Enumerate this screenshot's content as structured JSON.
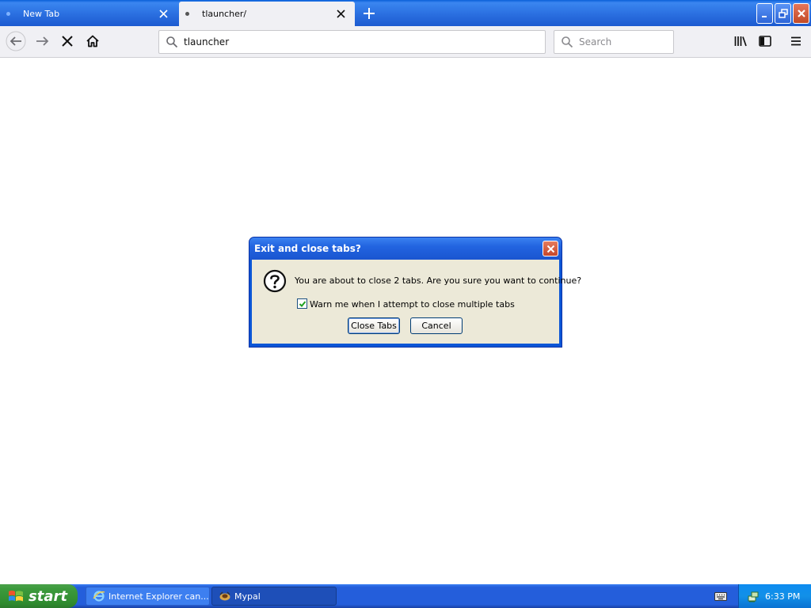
{
  "browser": {
    "tabs": [
      {
        "title": "New Tab",
        "active": false
      },
      {
        "title": "tlauncher/",
        "active": true
      }
    ],
    "url": "tlauncher",
    "search_placeholder": "Search"
  },
  "dialog": {
    "title": "Exit and close tabs?",
    "message": "You are about to close 2 tabs. Are you sure you want to continue?",
    "checkbox_label": "Warn me when I attempt to close multiple tabs",
    "checkbox_checked": true,
    "primary_button": "Close Tabs",
    "secondary_button": "Cancel"
  },
  "taskbar": {
    "start_label": "start",
    "items": [
      {
        "label": "Internet Explorer can...",
        "icon": "internet-explorer-icon"
      },
      {
        "label": "Mypal",
        "icon": "mypal-icon"
      }
    ],
    "clock": "6:33 PM"
  },
  "colors": {
    "titlebar": "#2a6fe0",
    "toolbar": "#f0f0f4",
    "dialog_body": "#ece9d8",
    "start_button": "#3c9a3c",
    "taskbar": "#245edb",
    "tray": "#1290e8"
  }
}
